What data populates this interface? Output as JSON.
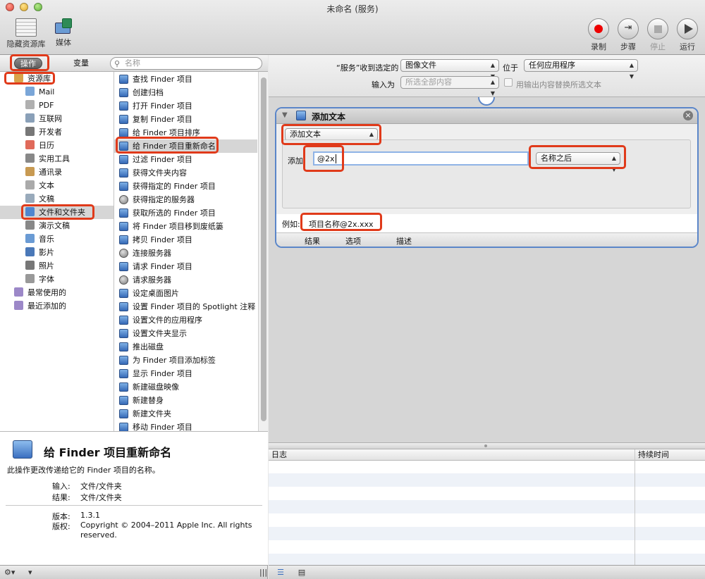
{
  "window": {
    "title": "未命名 (服务)"
  },
  "toolbar": {
    "hide_library_label": "隐藏资源库",
    "media_label": "媒体",
    "record_label": "录制",
    "step_label": "步骤",
    "stop_label": "停止",
    "run_label": "运行"
  },
  "left": {
    "tabs": {
      "actions": "操作",
      "variables": "变量"
    },
    "search_placeholder": "名称",
    "library": [
      {
        "label": "资源库",
        "icon": "library-icon",
        "indent": 0,
        "selected": false
      },
      {
        "label": "Mail",
        "icon": "mail-icon",
        "indent": 1
      },
      {
        "label": "PDF",
        "icon": "pdf-icon",
        "indent": 1
      },
      {
        "label": "互联网",
        "icon": "globe-icon",
        "indent": 1
      },
      {
        "label": "开发者",
        "icon": "tools-icon",
        "indent": 1
      },
      {
        "label": "日历",
        "icon": "calendar-icon",
        "indent": 1
      },
      {
        "label": "实用工具",
        "icon": "utilities-icon",
        "indent": 1
      },
      {
        "label": "通讯录",
        "icon": "contacts-icon",
        "indent": 1
      },
      {
        "label": "文本",
        "icon": "text-icon",
        "indent": 1
      },
      {
        "label": "文稿",
        "icon": "document-icon",
        "indent": 1
      },
      {
        "label": "文件和文件夹",
        "icon": "finder-icon",
        "indent": 1,
        "selected": true
      },
      {
        "label": "演示文稿",
        "icon": "presentation-icon",
        "indent": 1
      },
      {
        "label": "音乐",
        "icon": "music-icon",
        "indent": 1
      },
      {
        "label": "影片",
        "icon": "movie-icon",
        "indent": 1
      },
      {
        "label": "照片",
        "icon": "photo-icon",
        "indent": 1
      },
      {
        "label": "字体",
        "icon": "font-icon",
        "indent": 1
      },
      {
        "label": "最常使用的",
        "icon": "smart-folder-icon",
        "indent": 0
      },
      {
        "label": "最近添加的",
        "icon": "smart-folder-icon",
        "indent": 0
      }
    ],
    "actions": [
      {
        "label": "查找 Finder 项目",
        "icon": "finder-icon"
      },
      {
        "label": "创建归档",
        "icon": "finder-icon"
      },
      {
        "label": "打开 Finder 项目",
        "icon": "finder-icon"
      },
      {
        "label": "复制 Finder 项目",
        "icon": "finder-icon"
      },
      {
        "label": "给 Finder 项目排序",
        "icon": "finder-icon"
      },
      {
        "label": "给 Finder 项目重新命名",
        "icon": "finder-icon",
        "selected": true
      },
      {
        "label": "过滤 Finder 项目",
        "icon": "finder-icon"
      },
      {
        "label": "获得文件夹内容",
        "icon": "finder-icon"
      },
      {
        "label": "获得指定的 Finder 项目",
        "icon": "finder-icon"
      },
      {
        "label": "获得指定的服务器",
        "icon": "globe-icon"
      },
      {
        "label": "获取所选的 Finder 项目",
        "icon": "finder-icon"
      },
      {
        "label": "将 Finder 项目移到废纸篓",
        "icon": "finder-icon"
      },
      {
        "label": "拷贝 Finder 项目",
        "icon": "finder-icon"
      },
      {
        "label": "连接服务器",
        "icon": "globe-icon"
      },
      {
        "label": "请求 Finder 项目",
        "icon": "finder-icon"
      },
      {
        "label": "请求服务器",
        "icon": "globe-icon"
      },
      {
        "label": "设定桌面图片",
        "icon": "finder-icon"
      },
      {
        "label": "设置 Finder 项目的 Spotlight 注释",
        "icon": "finder-icon"
      },
      {
        "label": "设置文件的应用程序",
        "icon": "finder-icon"
      },
      {
        "label": "设置文件夹显示",
        "icon": "finder-icon"
      },
      {
        "label": "推出磁盘",
        "icon": "finder-icon"
      },
      {
        "label": "为 Finder 项目添加标签",
        "icon": "finder-icon"
      },
      {
        "label": "显示 Finder 项目",
        "icon": "finder-icon"
      },
      {
        "label": "新建磁盘映像",
        "icon": "finder-icon"
      },
      {
        "label": "新建替身",
        "icon": "finder-icon"
      },
      {
        "label": "新建文件夹",
        "icon": "finder-icon"
      },
      {
        "label": "移动 Finder 项目",
        "icon": "finder-icon"
      }
    ],
    "description": {
      "title": "给 Finder 项目重新命名",
      "summary": "此操作更改传递给它的 Finder 项目的名称。",
      "input_key": "输入:",
      "input_value": "文件/文件夹",
      "result_key": "结果:",
      "result_value": "文件/文件夹",
      "version_key": "版本:",
      "version_value": "1.3.1",
      "copyright_key": "版权:",
      "copyright_value": "Copyright © 2004–2011 Apple Inc.  All rights reserved."
    }
  },
  "right": {
    "header": {
      "service_receives_label": "“服务”收到选定的",
      "receives_value": "图像文件",
      "in_label": "位于",
      "app_value": "任何应用程序",
      "input_is_label": "输入为",
      "input_value": "所选全部内容",
      "replace_label": "用输出内容替换所选文本"
    },
    "action": {
      "title": "添加文本",
      "mode_value": "添加文本",
      "add_label": "添加",
      "add_text_value": "@2x",
      "position_value": "名称之后",
      "example_label": "例如:",
      "example_value": "项目名称@2x.xxx",
      "footer_tabs": [
        "结果",
        "选项",
        "描述"
      ]
    },
    "log": {
      "col_log": "日志",
      "col_duration": "持续时间"
    }
  },
  "colors": {
    "accent": "#5b86c9",
    "highlight": "#e03a1a",
    "record": "#e00000"
  }
}
